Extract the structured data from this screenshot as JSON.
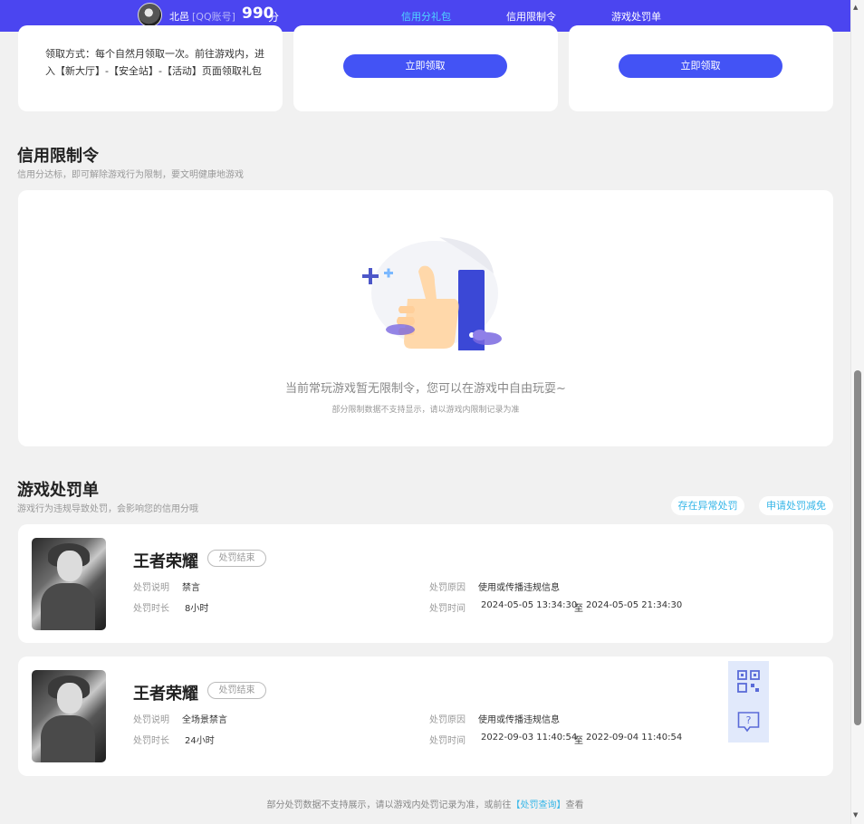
{
  "header": {
    "username": "北邑",
    "account_type": "[QQ账号]",
    "score": "990",
    "score_unit": "分",
    "tabs": [
      {
        "label": "信用分礼包",
        "active": true
      },
      {
        "label": "信用限制令",
        "active": false
      },
      {
        "label": "游戏处罚单",
        "active": false
      }
    ]
  },
  "gift_cards": {
    "claim_text": "领取方式：每个自然月领取一次。前往游戏内，进入【新大厅】-【安全站】-【活动】页面领取礼包",
    "claim_button_label": "立即领取"
  },
  "restriction": {
    "title": "信用限制令",
    "subtitle": "信用分达标，即可解除游戏行为限制，要文明健康地游戏",
    "empty_message": "当前常玩游戏暂无限制令，您可以在游戏中自由玩耍~",
    "empty_note": "部分限制数据不支持显示，请以游戏内限制记录为准"
  },
  "penalties": {
    "title": "游戏处罚单",
    "subtitle": "游戏行为违规导致处罚，会影响您的信用分哦",
    "abnormal_button": "存在异常处罚",
    "appeal_button": "申请处罚减免",
    "labels": {
      "desc": "处罚说明",
      "duration": "处罚时长",
      "reason": "处罚原因",
      "time": "处罚时间",
      "to": "至"
    },
    "items": [
      {
        "game": "王者荣耀",
        "status": "处罚结束",
        "desc": "禁言",
        "duration": "8小时",
        "reason": "使用或传播违规信息",
        "start": "2024-05-05 13:34:30",
        "end": "2024-05-05 21:34:30"
      },
      {
        "game": "王者荣耀",
        "status": "处罚结束",
        "desc": "全场景禁言",
        "duration": "24小时",
        "reason": "使用或传播违规信息",
        "start": "2022-09-03 11:40:54",
        "end": "2022-09-04 11:40:54"
      }
    ]
  },
  "footer": {
    "text_before": "部分处罚数据不支持展示，请以游戏内处罚记录为准，或前往",
    "link": "【处罚查询】",
    "text_after": "查看"
  },
  "colors": {
    "brand": "#4b45f0",
    "button": "#4353f5",
    "accent": "#35b6e8"
  },
  "icons": [
    "qr-code-icon",
    "help-chat-icon",
    "thumbs-up-illustration",
    "scroll-up-arrow",
    "scroll-down-arrow"
  ]
}
